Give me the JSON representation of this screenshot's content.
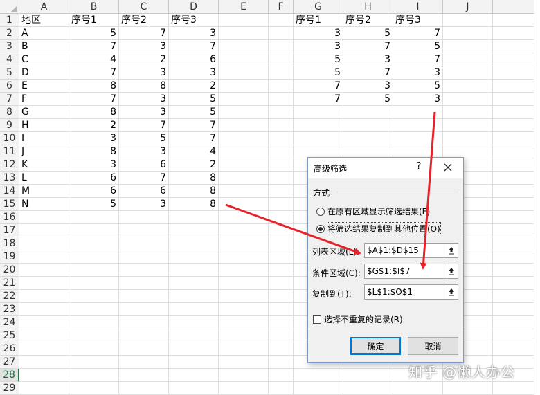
{
  "columns": [
    "A",
    "B",
    "C",
    "D",
    "E",
    "F",
    "G",
    "H",
    "I",
    "J"
  ],
  "rows": [
    "1",
    "2",
    "3",
    "4",
    "5",
    "6",
    "7",
    "8",
    "9",
    "10",
    "11",
    "12",
    "13",
    "14",
    "15",
    "16",
    "17",
    "18",
    "19",
    "20",
    "21",
    "22",
    "23",
    "24",
    "25",
    "26",
    "27",
    "28",
    "29"
  ],
  "active_row": "28",
  "main_table": {
    "headers": [
      "地区",
      "序号1",
      "序号2",
      "序号3"
    ],
    "rows": [
      [
        "A",
        "5",
        "7",
        "3"
      ],
      [
        "B",
        "7",
        "3",
        "7"
      ],
      [
        "C",
        "4",
        "2",
        "6"
      ],
      [
        "D",
        "7",
        "3",
        "3"
      ],
      [
        "E",
        "8",
        "8",
        "2"
      ],
      [
        "F",
        "7",
        "3",
        "5"
      ],
      [
        "G",
        "8",
        "3",
        "5"
      ],
      [
        "H",
        "2",
        "7",
        "7"
      ],
      [
        "I",
        "3",
        "5",
        "7"
      ],
      [
        "J",
        "8",
        "3",
        "4"
      ],
      [
        "K",
        "3",
        "6",
        "2"
      ],
      [
        "L",
        "6",
        "7",
        "8"
      ],
      [
        "M",
        "6",
        "6",
        "8"
      ],
      [
        "N",
        "5",
        "3",
        "8"
      ]
    ]
  },
  "criteria_table": {
    "headers": [
      "序号1",
      "序号2",
      "序号3"
    ],
    "rows": [
      [
        "3",
        "5",
        "7"
      ],
      [
        "3",
        "7",
        "5"
      ],
      [
        "5",
        "3",
        "7"
      ],
      [
        "5",
        "7",
        "3"
      ],
      [
        "7",
        "3",
        "5"
      ],
      [
        "7",
        "5",
        "3"
      ]
    ]
  },
  "dialog": {
    "title": "高级筛选",
    "help": "?",
    "section": "方式",
    "radio1": "在原有区域显示筛选结果(F)",
    "radio2": "将筛选结果复制到其他位置(O)",
    "list_label": "列表区域(L):",
    "list_value": "$A$1:$D$15",
    "criteria_label": "条件区域(C):",
    "criteria_value": "$G$1:$I$7",
    "copy_label": "复制到(T):",
    "copy_value": "$L$1:$O$1",
    "unique_label": "选择不重复的记录(R)",
    "ok": "确定",
    "cancel": "取消"
  },
  "watermark": "知乎 @懒人办公",
  "colors": {
    "arrow": "#e5232a",
    "accent": "#217346",
    "ok_border": "#0078d7"
  }
}
